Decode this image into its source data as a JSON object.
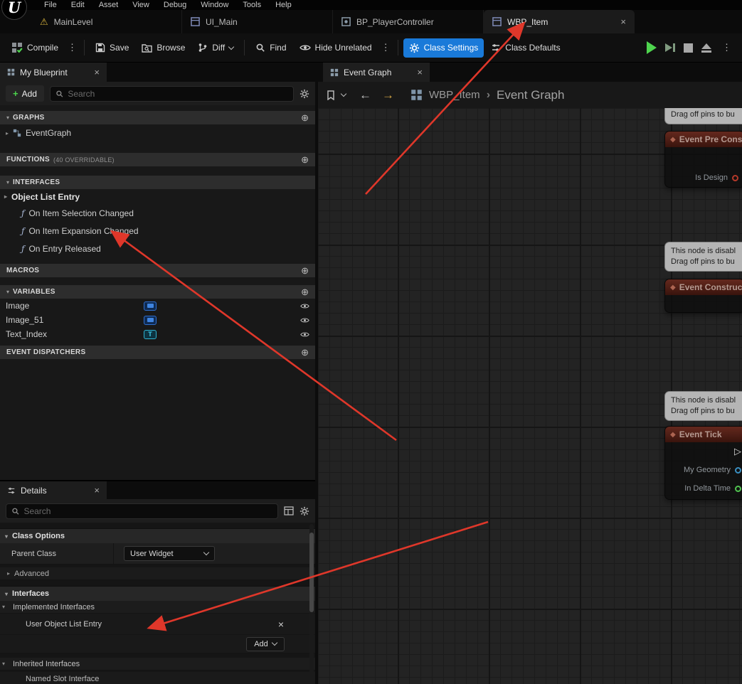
{
  "colors": {
    "accent_blue": "#1a7ad9",
    "play_green": "#4ed44e",
    "annotation_arrow_red": "#df372a",
    "node_header_red": "#5c1f15",
    "graph_background": "#232323"
  },
  "icons": {
    "logo_glyph": "U",
    "warning": "⚠",
    "close": "×",
    "circle_plus": "⊕",
    "overflow_dots": "⋮",
    "add_plus": "+",
    "caret_down": "▾",
    "caret_right": "▸",
    "crumb_chevron": "›",
    "diamond": "◆",
    "exec_pin": "▷",
    "nav_back": "←",
    "nav_forward": "→",
    "text_type": "T"
  },
  "menubar": {
    "items": [
      "File",
      "Edit",
      "Asset",
      "View",
      "Debug",
      "Window",
      "Tools",
      "Help"
    ]
  },
  "asset_tabs": {
    "tabs": [
      {
        "label": "MainLevel"
      },
      {
        "label": "UI_Main"
      },
      {
        "label": "BP_PlayerController"
      },
      {
        "label": "WBP_Item"
      }
    ]
  },
  "toolbar": {
    "compile_label": "Compile",
    "save_label": "Save",
    "browse_label": "Browse",
    "diff_label": "Diff",
    "find_label": "Find",
    "hide_unrelated_label": "Hide Unrelated",
    "class_settings_label": "Class Settings",
    "class_defaults_label": "Class Defaults"
  },
  "my_blueprint": {
    "tab_title": "My Blueprint",
    "add_label": "Add",
    "search_placeholder": "Search",
    "graphs_title": "GRAPHS",
    "eventgraph_label": "EventGraph",
    "functions_title": "FUNCTIONS",
    "functions_subtitle": "(40 OVERRIDABLE)",
    "interfaces_title": "INTERFACES",
    "interface_group": "Object List Entry",
    "interface_items": [
      {
        "label": "On Item Selection Changed"
      },
      {
        "label": "On Item Expansion Changed"
      },
      {
        "label": "On Entry Released"
      }
    ],
    "macros_title": "MACROS",
    "variables_title": "VARIABLES",
    "variables": [
      {
        "name": "Image",
        "type": "image"
      },
      {
        "name": "Image_51",
        "type": "image"
      },
      {
        "name": "Text_Index",
        "type": "text"
      }
    ],
    "event_dispatchers_title": "EVENT DISPATCHERS"
  },
  "details": {
    "tab_title": "Details",
    "search_placeholder": "Search",
    "class_options_title": "Class Options",
    "parent_class_label": "Parent Class",
    "parent_class_value": "User Widget",
    "advanced_label": "Advanced",
    "interfaces_title": "Interfaces",
    "implemented_label": "Implemented Interfaces",
    "implemented_item": "User Object List Entry",
    "add_button_label": "Add",
    "inherited_label": "Inherited Interfaces",
    "inherited_item": "Named Slot Interface"
  },
  "graph": {
    "tab_title": "Event Graph",
    "breadcrumb_root": "WBP_Item",
    "breadcrumb_page": "Event Graph",
    "disabled_note_line1": "This node is disabl",
    "disabled_note_line2": "Drag off pins to bu",
    "nodes": [
      {
        "title": "Event Pre Cons",
        "pin1": "Is Design"
      },
      {
        "title": "Event Construc"
      },
      {
        "title": "Event Tick",
        "pin1": "My Geometry",
        "pin2": "In Delta Time"
      }
    ]
  }
}
